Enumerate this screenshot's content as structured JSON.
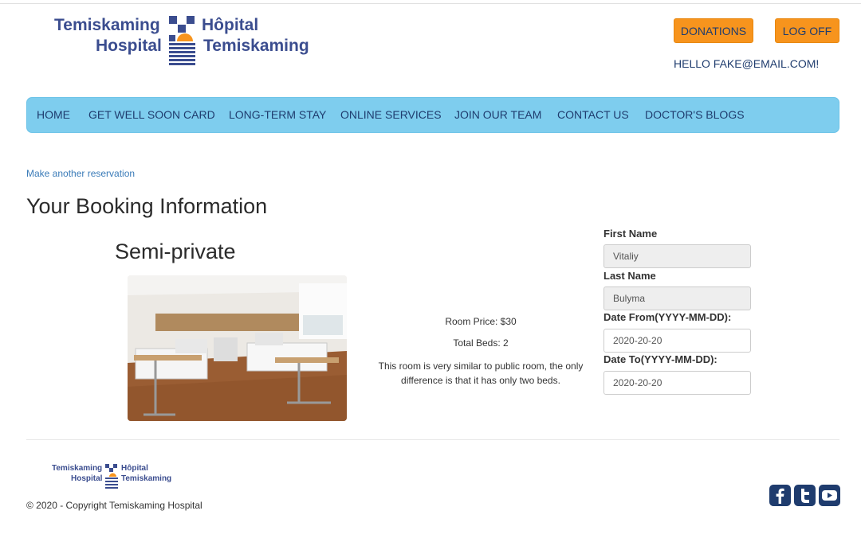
{
  "logo": {
    "line1_left": "Temiskaming",
    "line2_left": "Hospital",
    "line1_right": "Hôpital",
    "line2_right": "Temiskaming"
  },
  "header": {
    "donations_label": "DONATIONS",
    "logoff_label": "LOG OFF",
    "greeting": "HELLO FAKE@EMAIL.COM!"
  },
  "nav": {
    "items": [
      {
        "label": "HOME"
      },
      {
        "label": "GET WELL SOON CARD"
      },
      {
        "label": "LONG-TERM STAY"
      },
      {
        "label": "ONLINE SERVICES"
      },
      {
        "label": "JOIN OUR TEAM"
      },
      {
        "label": "CONTACT US"
      },
      {
        "label": "DOCTOR'S BLOGS"
      }
    ]
  },
  "main": {
    "reserve_link": "Make another reservation",
    "title": "Your Booking Information",
    "room": {
      "name": "Semi-private",
      "price": "Room Price: $30",
      "beds": "Total Beds: 2",
      "description": "This room is very similar to public room, the only difference is that it has only two beds."
    },
    "form": {
      "first_name_label": "First Name",
      "first_name_value": "Vitaliy",
      "last_name_label": "Last Name",
      "last_name_value": "Bulyma",
      "date_from_label": "Date From(YYYY-MM-DD):",
      "date_from_value": "2020-20-20",
      "date_to_label": "Date To(YYYY-MM-DD):",
      "date_to_value": "2020-20-20"
    }
  },
  "footer": {
    "copyright": "© 2020 - Copyright Temiskaming Hospital",
    "social": [
      {
        "icon": "facebook-icon"
      },
      {
        "icon": "twitter-icon"
      },
      {
        "icon": "youtube-icon"
      }
    ]
  },
  "colors": {
    "nav_bg": "#7ecdee",
    "button_orange": "#f7941d",
    "brand_blue": "#3b4d8f",
    "dark_navy": "#1f3c6e"
  }
}
